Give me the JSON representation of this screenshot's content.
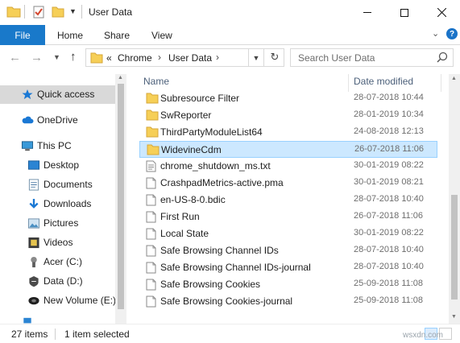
{
  "window": {
    "title": "User Data",
    "colors": {
      "accent": "#1979ca",
      "selection": "#cce8ff",
      "folder": "#f6cf57"
    }
  },
  "ribbon": {
    "tabs": [
      "File",
      "Home",
      "Share",
      "View"
    ]
  },
  "address": {
    "prefix": "«",
    "crumbs": [
      "Chrome",
      "User Data"
    ],
    "search_placeholder": "Search User Data"
  },
  "navpane": {
    "items": [
      {
        "label": "Quick access",
        "icon": "star-icon",
        "selected": true
      },
      {
        "label": "OneDrive",
        "icon": "cloud-icon"
      },
      {
        "label": "This PC",
        "icon": "computer-icon"
      },
      {
        "label": "Desktop",
        "icon": "desktop-icon"
      },
      {
        "label": "Documents",
        "icon": "documents-icon"
      },
      {
        "label": "Downloads",
        "icon": "download-arrow-icon"
      },
      {
        "label": "Pictures",
        "icon": "pictures-icon"
      },
      {
        "label": "Videos",
        "icon": "videos-icon"
      },
      {
        "label": "Acer (C:)",
        "icon": "drive-icon"
      },
      {
        "label": "Data (D:)",
        "icon": "drive-icon"
      },
      {
        "label": "New Volume (E:)",
        "icon": "drive-icon"
      }
    ]
  },
  "list": {
    "headers": {
      "name": "Name",
      "date": "Date modified"
    },
    "rows": [
      {
        "name": "Subresource Filter",
        "date": "28-07-2018 10:44",
        "type": "folder"
      },
      {
        "name": "SwReporter",
        "date": "28-01-2019 10:34",
        "type": "folder"
      },
      {
        "name": "ThirdPartyModuleList64",
        "date": "24-08-2018 12:13",
        "type": "folder"
      },
      {
        "name": "WidevineCdm",
        "date": "26-07-2018 11:06",
        "type": "folder",
        "selected": true
      },
      {
        "name": "chrome_shutdown_ms.txt",
        "date": "30-01-2019 08:22",
        "type": "text"
      },
      {
        "name": "CrashpadMetrics-active.pma",
        "date": "30-01-2019 08:21",
        "type": "file"
      },
      {
        "name": "en-US-8-0.bdic",
        "date": "28-07-2018 10:40",
        "type": "file"
      },
      {
        "name": "First Run",
        "date": "26-07-2018 11:06",
        "type": "file"
      },
      {
        "name": "Local State",
        "date": "30-01-2019 08:22",
        "type": "file"
      },
      {
        "name": "Safe Browsing Channel IDs",
        "date": "28-07-2018 10:40",
        "type": "file"
      },
      {
        "name": "Safe Browsing Channel IDs-journal",
        "date": "28-07-2018 10:40",
        "type": "file"
      },
      {
        "name": "Safe Browsing Cookies",
        "date": "25-09-2018 11:08",
        "type": "file"
      },
      {
        "name": "Safe Browsing Cookies-journal",
        "date": "25-09-2018 11:08",
        "type": "file"
      }
    ]
  },
  "status": {
    "count": "27 items",
    "selection": "1 item selected"
  },
  "watermark": "wsxdn.com"
}
